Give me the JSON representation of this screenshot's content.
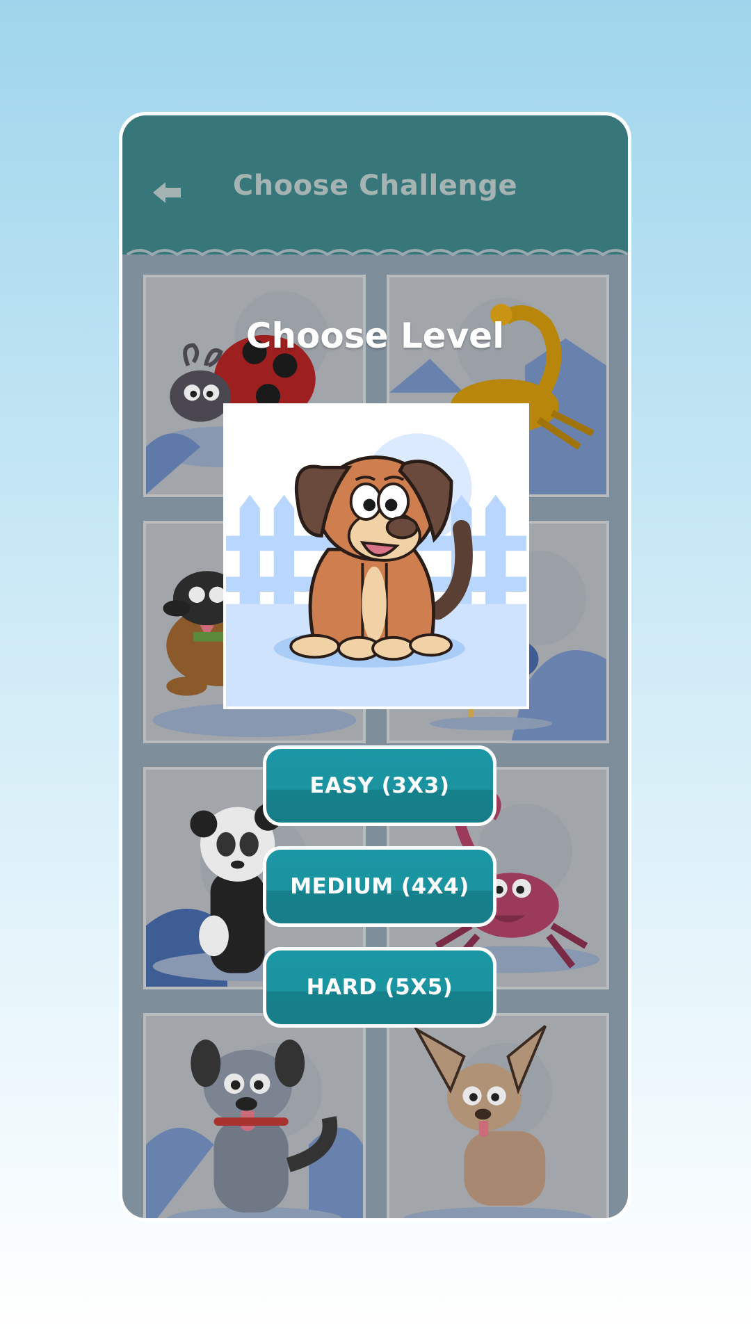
{
  "header": {
    "title": "Choose Challenge",
    "back_icon": "back-arrow-icon"
  },
  "colors": {
    "header": "#37777a",
    "button": "#1b93a0",
    "overlay": "#7f8e9b"
  },
  "puzzles": [
    {
      "animal": "ladybug"
    },
    {
      "animal": "scorpion"
    },
    {
      "animal": "dachshund"
    },
    {
      "animal": "bird"
    },
    {
      "animal": "panda"
    },
    {
      "animal": "crab"
    },
    {
      "animal": "grey dog"
    },
    {
      "animal": "chihuahua"
    }
  ],
  "level_dialog": {
    "title": "Choose Level",
    "selected_puzzle": "dog",
    "buttons": [
      {
        "label": "EASY (3X3)"
      },
      {
        "label": "MEDIUM (4X4)"
      },
      {
        "label": "HARD (5X5)"
      }
    ]
  }
}
